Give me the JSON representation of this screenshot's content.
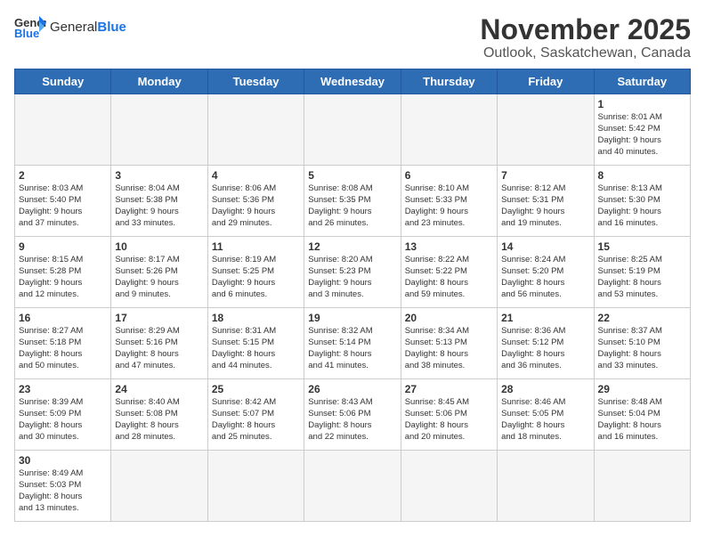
{
  "header": {
    "logo_general": "General",
    "logo_blue": "Blue",
    "month": "November 2025",
    "location": "Outlook, Saskatchewan, Canada"
  },
  "weekdays": [
    "Sunday",
    "Monday",
    "Tuesday",
    "Wednesday",
    "Thursday",
    "Friday",
    "Saturday"
  ],
  "days": [
    {
      "num": "",
      "info": ""
    },
    {
      "num": "",
      "info": ""
    },
    {
      "num": "",
      "info": ""
    },
    {
      "num": "",
      "info": ""
    },
    {
      "num": "",
      "info": ""
    },
    {
      "num": "",
      "info": ""
    },
    {
      "num": "1",
      "info": "Sunrise: 8:01 AM\nSunset: 5:42 PM\nDaylight: 9 hours\nand 40 minutes."
    },
    {
      "num": "2",
      "info": "Sunrise: 8:03 AM\nSunset: 5:40 PM\nDaylight: 9 hours\nand 37 minutes."
    },
    {
      "num": "3",
      "info": "Sunrise: 8:04 AM\nSunset: 5:38 PM\nDaylight: 9 hours\nand 33 minutes."
    },
    {
      "num": "4",
      "info": "Sunrise: 8:06 AM\nSunset: 5:36 PM\nDaylight: 9 hours\nand 29 minutes."
    },
    {
      "num": "5",
      "info": "Sunrise: 8:08 AM\nSunset: 5:35 PM\nDaylight: 9 hours\nand 26 minutes."
    },
    {
      "num": "6",
      "info": "Sunrise: 8:10 AM\nSunset: 5:33 PM\nDaylight: 9 hours\nand 23 minutes."
    },
    {
      "num": "7",
      "info": "Sunrise: 8:12 AM\nSunset: 5:31 PM\nDaylight: 9 hours\nand 19 minutes."
    },
    {
      "num": "8",
      "info": "Sunrise: 8:13 AM\nSunset: 5:30 PM\nDaylight: 9 hours\nand 16 minutes."
    },
    {
      "num": "9",
      "info": "Sunrise: 8:15 AM\nSunset: 5:28 PM\nDaylight: 9 hours\nand 12 minutes."
    },
    {
      "num": "10",
      "info": "Sunrise: 8:17 AM\nSunset: 5:26 PM\nDaylight: 9 hours\nand 9 minutes."
    },
    {
      "num": "11",
      "info": "Sunrise: 8:19 AM\nSunset: 5:25 PM\nDaylight: 9 hours\nand 6 minutes."
    },
    {
      "num": "12",
      "info": "Sunrise: 8:20 AM\nSunset: 5:23 PM\nDaylight: 9 hours\nand 3 minutes."
    },
    {
      "num": "13",
      "info": "Sunrise: 8:22 AM\nSunset: 5:22 PM\nDaylight: 8 hours\nand 59 minutes."
    },
    {
      "num": "14",
      "info": "Sunrise: 8:24 AM\nSunset: 5:20 PM\nDaylight: 8 hours\nand 56 minutes."
    },
    {
      "num": "15",
      "info": "Sunrise: 8:25 AM\nSunset: 5:19 PM\nDaylight: 8 hours\nand 53 minutes."
    },
    {
      "num": "16",
      "info": "Sunrise: 8:27 AM\nSunset: 5:18 PM\nDaylight: 8 hours\nand 50 minutes."
    },
    {
      "num": "17",
      "info": "Sunrise: 8:29 AM\nSunset: 5:16 PM\nDaylight: 8 hours\nand 47 minutes."
    },
    {
      "num": "18",
      "info": "Sunrise: 8:31 AM\nSunset: 5:15 PM\nDaylight: 8 hours\nand 44 minutes."
    },
    {
      "num": "19",
      "info": "Sunrise: 8:32 AM\nSunset: 5:14 PM\nDaylight: 8 hours\nand 41 minutes."
    },
    {
      "num": "20",
      "info": "Sunrise: 8:34 AM\nSunset: 5:13 PM\nDaylight: 8 hours\nand 38 minutes."
    },
    {
      "num": "21",
      "info": "Sunrise: 8:36 AM\nSunset: 5:12 PM\nDaylight: 8 hours\nand 36 minutes."
    },
    {
      "num": "22",
      "info": "Sunrise: 8:37 AM\nSunset: 5:10 PM\nDaylight: 8 hours\nand 33 minutes."
    },
    {
      "num": "23",
      "info": "Sunrise: 8:39 AM\nSunset: 5:09 PM\nDaylight: 8 hours\nand 30 minutes."
    },
    {
      "num": "24",
      "info": "Sunrise: 8:40 AM\nSunset: 5:08 PM\nDaylight: 8 hours\nand 28 minutes."
    },
    {
      "num": "25",
      "info": "Sunrise: 8:42 AM\nSunset: 5:07 PM\nDaylight: 8 hours\nand 25 minutes."
    },
    {
      "num": "26",
      "info": "Sunrise: 8:43 AM\nSunset: 5:06 PM\nDaylight: 8 hours\nand 22 minutes."
    },
    {
      "num": "27",
      "info": "Sunrise: 8:45 AM\nSunset: 5:06 PM\nDaylight: 8 hours\nand 20 minutes."
    },
    {
      "num": "28",
      "info": "Sunrise: 8:46 AM\nSunset: 5:05 PM\nDaylight: 8 hours\nand 18 minutes."
    },
    {
      "num": "29",
      "info": "Sunrise: 8:48 AM\nSunset: 5:04 PM\nDaylight: 8 hours\nand 16 minutes."
    },
    {
      "num": "30",
      "info": "Sunrise: 8:49 AM\nSunset: 5:03 PM\nDaylight: 8 hours\nand 13 minutes."
    },
    {
      "num": "",
      "info": ""
    },
    {
      "num": "",
      "info": ""
    },
    {
      "num": "",
      "info": ""
    },
    {
      "num": "",
      "info": ""
    },
    {
      "num": "",
      "info": ""
    },
    {
      "num": "",
      "info": ""
    }
  ]
}
